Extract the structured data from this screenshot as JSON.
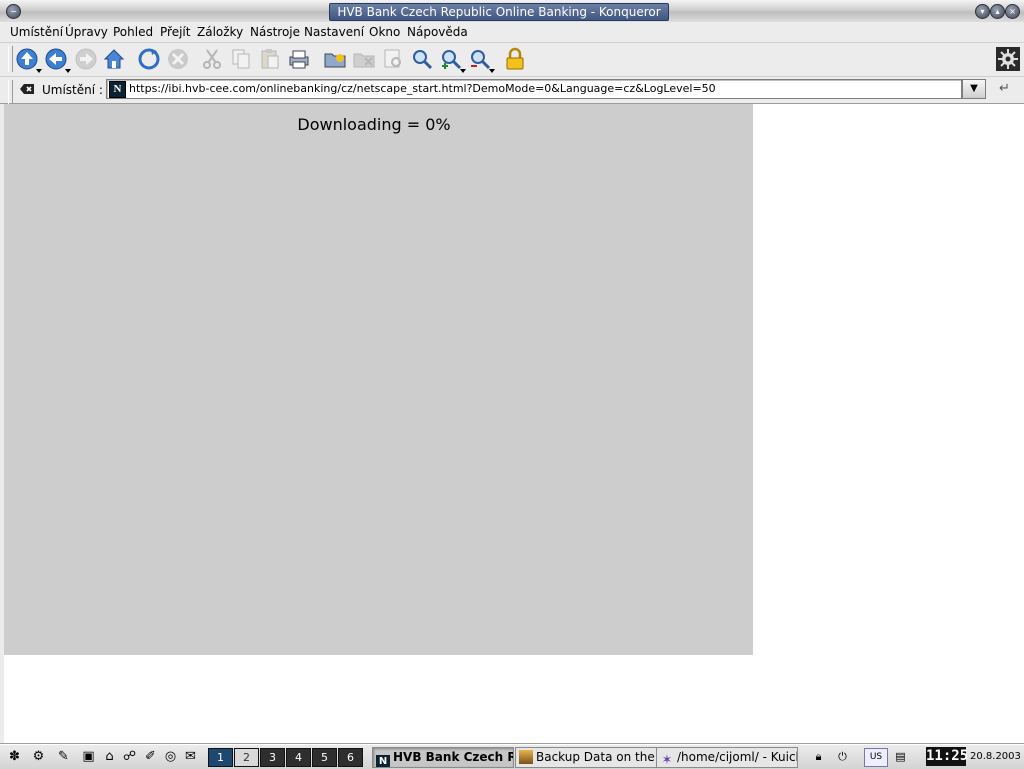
{
  "window": {
    "title": "HVB Bank Czech Republic Online Banking - Konqueror"
  },
  "menubar": {
    "items": [
      "Umístění",
      "Úpravy",
      "Pohled",
      "Přejít",
      "Záložky",
      "Nástroje",
      "Nastavení",
      "Okno",
      "Nápověda"
    ]
  },
  "toolbar": {
    "icons": [
      "up-arrow-icon",
      "back-arrow-icon",
      "forward-arrow-icon",
      "home-icon",
      "reload-icon",
      "stop-icon",
      "cut-icon",
      "copy-icon",
      "paste-icon",
      "print-icon",
      "new-folder-icon",
      "delete-folder-icon",
      "print-preview-icon",
      "zoom-icon",
      "zoom-in-icon",
      "zoom-out-icon",
      "security-lock-icon"
    ]
  },
  "location": {
    "label": "Umístění :",
    "site_icon_letter": "N",
    "url": "https://ibi.hvb-cee.com/onlinebanking/cz/netscape_start.html?DemoMode=0&Language=cz&LogLevel=50"
  },
  "content": {
    "progress_text": "Downloading = 0%",
    "applet_background": "#cdcdcd"
  },
  "taskbar": {
    "desktops": [
      "1",
      "2",
      "3",
      "4",
      "5",
      "6"
    ],
    "active_desktop": "1",
    "tasks": [
      {
        "label": "HVB Bank Czech Re",
        "active": true
      },
      {
        "label": "Backup Data on the",
        "active": false
      },
      {
        "label": "/home/cijoml/ - Kuick",
        "active": false
      }
    ],
    "keyboard_layout": "US",
    "clock": "11:25",
    "date": "20.8.2003"
  },
  "colors": {
    "title_active": "#4a5f8a",
    "ui_background": "#ececec",
    "clock_background": "#111111"
  }
}
